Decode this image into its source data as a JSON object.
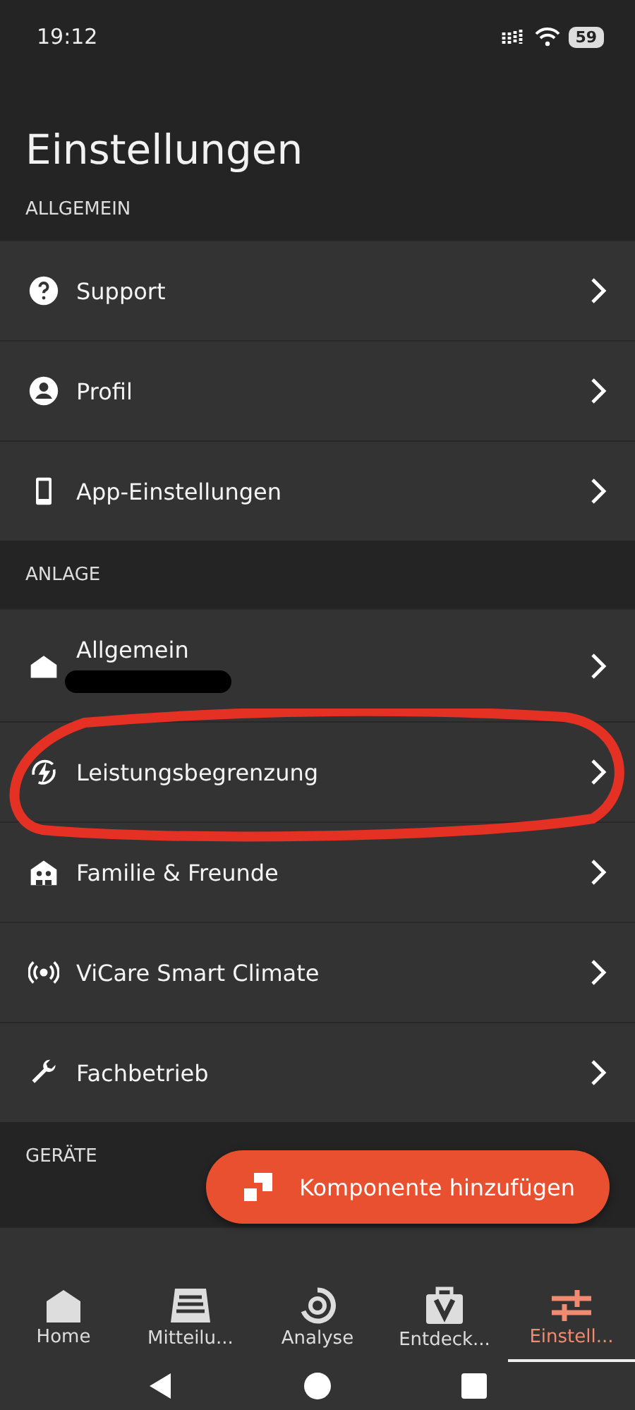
{
  "status_bar": {
    "time": "19:12",
    "battery": "59"
  },
  "title": "Einstellungen",
  "sections": [
    {
      "header": "ALLGEMEIN",
      "rows": [
        {
          "label": "Support"
        },
        {
          "label": "Profil"
        },
        {
          "label": "App-Einstellungen"
        }
      ]
    },
    {
      "header": "ANLAGE",
      "rows": [
        {
          "label": "Allgemein",
          "redacted": true
        },
        {
          "label": "Leistungsbegrenzung",
          "highlighted": true
        },
        {
          "label": "Familie & Freunde"
        },
        {
          "label": "ViCare Smart Climate"
        },
        {
          "label": "Fachbetrieb"
        }
      ]
    },
    {
      "header": "GERÄTE"
    }
  ],
  "fab": {
    "label": "Komponente hinzufügen"
  },
  "bottom_nav": [
    {
      "label": "Home",
      "selected": false
    },
    {
      "label": "Mitteilu...",
      "selected": false
    },
    {
      "label": "Analyse",
      "selected": false
    },
    {
      "label": "Entdeck...",
      "selected": false
    },
    {
      "label": "Einstell...",
      "selected": true
    }
  ]
}
